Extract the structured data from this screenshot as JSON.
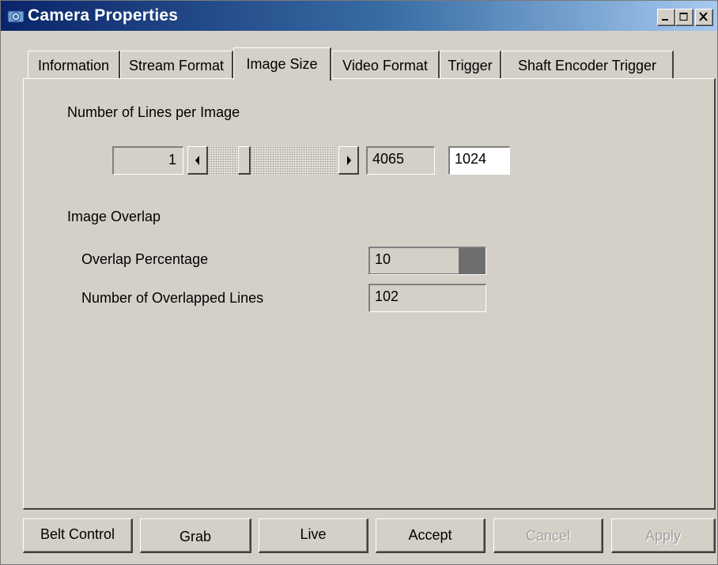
{
  "window": {
    "title": "Camera Properties",
    "icon": "camera-app-icon",
    "controls": [
      "minimize-icon",
      "maximize-icon",
      "close-icon"
    ]
  },
  "tabs": [
    {
      "label": "Information",
      "active": false
    },
    {
      "label": "Stream Format",
      "active": false
    },
    {
      "label": "Image Size",
      "active": true
    },
    {
      "label": "Video Format",
      "active": false
    },
    {
      "label": "Trigger",
      "active": false
    },
    {
      "label": "Shaft Encoder Trigger",
      "active": false
    }
  ],
  "lines_per_image": {
    "heading": "Number of Lines per Image",
    "min": "1",
    "max": "4065",
    "value": "1024"
  },
  "overlap": {
    "heading": "Image Overlap",
    "percentage_label": "Overlap Percentage",
    "percentage_value": "10",
    "lines_label": "Number of Overlapped Lines",
    "lines_value": "102"
  },
  "buttons": {
    "belt_control": "Belt Control",
    "grab": "Grab",
    "live": "Live",
    "accept": "Accept",
    "cancel": "Cancel",
    "apply": "Apply"
  }
}
